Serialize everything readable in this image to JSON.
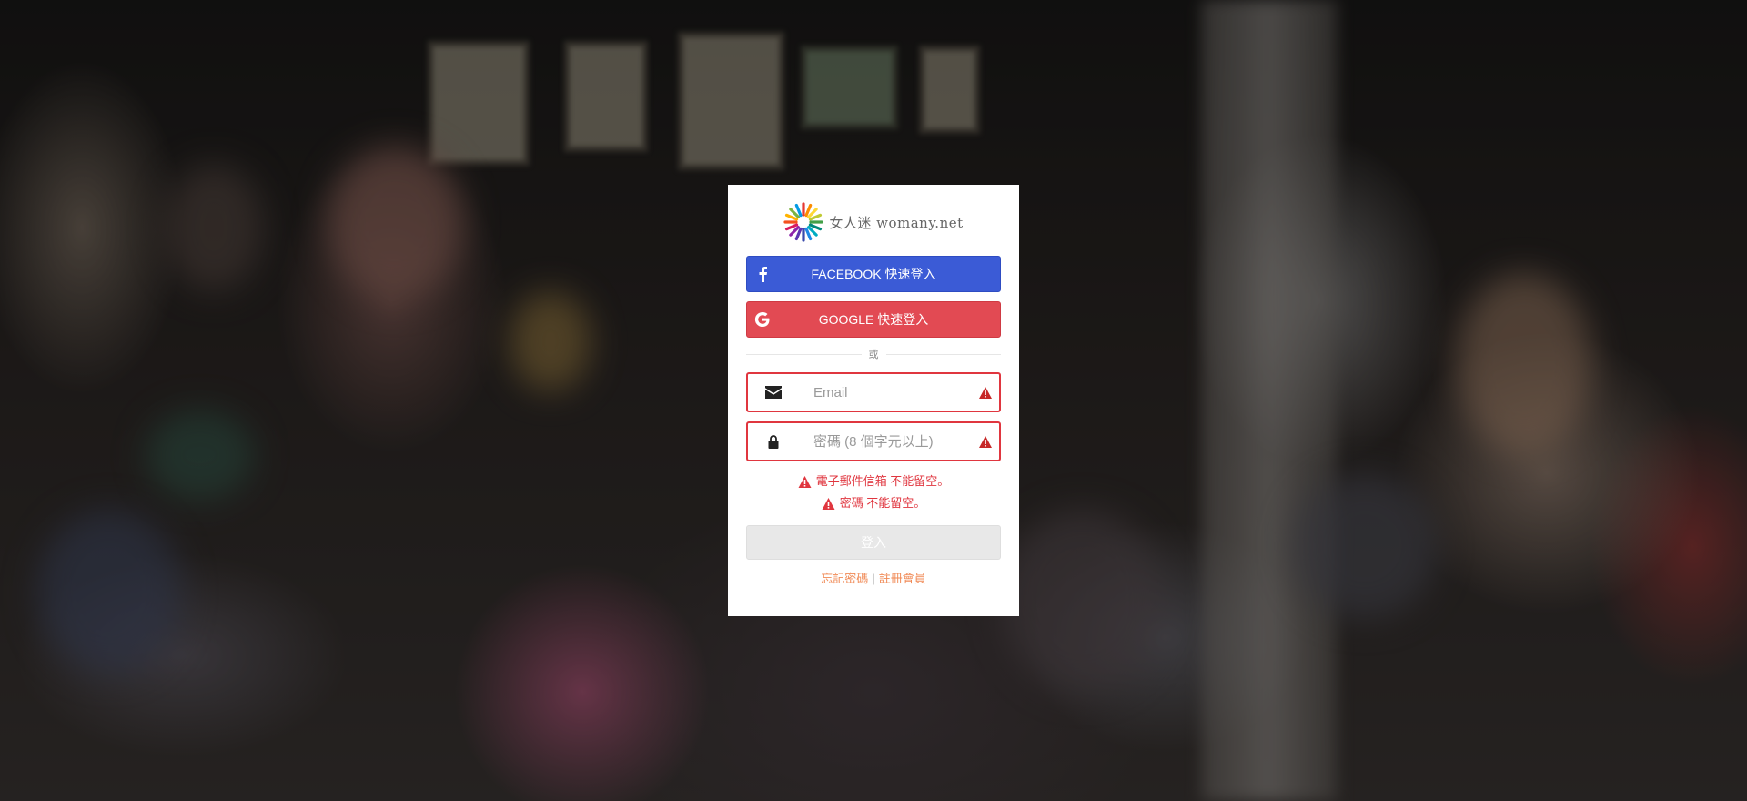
{
  "background": {
    "description_free": true
  },
  "brand": {
    "logo_text": "女人迷 womany.net",
    "logo_icon": "sunburst-logo-icon"
  },
  "social_login": {
    "facebook_label": "FACEBOOK 快速登入",
    "facebook_icon": "facebook-icon",
    "facebook_color": "#3b5bd6",
    "google_label": "GOOGLE 快速登入",
    "google_icon": "google-icon",
    "google_color": "#e24a53"
  },
  "divider": {
    "text": "或"
  },
  "form": {
    "email": {
      "placeholder": "Email",
      "value": "",
      "icon": "envelope-icon",
      "status_icon": "warning-icon"
    },
    "password": {
      "placeholder": "密碼 (8 個字元以上)",
      "value": "",
      "icon": "lock-icon",
      "status_icon": "warning-icon"
    },
    "error_color": "#e0363f",
    "errors": [
      "電子郵件信箱 不能留空。",
      "密碼 不能留空。"
    ],
    "submit_label": "登入"
  },
  "links": {
    "forgot_password": "忘記密碼",
    "separator": "|",
    "register": "註冊會員",
    "color": "#f08a56"
  }
}
